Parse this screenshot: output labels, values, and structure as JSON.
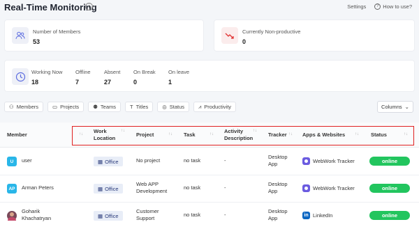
{
  "header": {
    "title": "Real-Time Monitoring",
    "settings": "Settings",
    "how_to_use": "How to use?"
  },
  "cards": {
    "members": {
      "label": "Number of Members",
      "value": "53"
    },
    "non_productive": {
      "label": "Currently Non-productive",
      "value": "0"
    },
    "stats": [
      {
        "label": "Working Now",
        "value": "18"
      },
      {
        "label": "Offline",
        "value": "7"
      },
      {
        "label": "Absent",
        "value": "27"
      },
      {
        "label": "On Break",
        "value": "0"
      },
      {
        "label": "On leave",
        "value": "1"
      }
    ]
  },
  "tabs": [
    "Members",
    "Projects",
    "Teams",
    "Titles",
    "Status",
    "Productivity"
  ],
  "columns_button": "Columns",
  "table": {
    "headers": {
      "member": "Member",
      "work_location_1": "Work",
      "work_location_2": "Location",
      "project": "Project",
      "task": "Task",
      "activity_1": "Activity",
      "activity_2": "Description",
      "tracker": "Tracker",
      "apps": "Apps & Websites",
      "status": "Status"
    },
    "rows": [
      {
        "initials": "U",
        "avatar_color": "#29b6e8",
        "name_1": "user",
        "name_2": "",
        "location": "Office",
        "project_1": "No project",
        "project_2": "",
        "task": "no task",
        "activity": "-",
        "tracker_1": "Desktop",
        "tracker_2": "App",
        "app": "WebWork Tracker",
        "status": "online"
      },
      {
        "initials": "AP",
        "avatar_color": "#29b6e8",
        "name_1": "Arman Peters",
        "name_2": "",
        "location": "Office",
        "project_1": "Web APP",
        "project_2": "Development",
        "task": "no task",
        "activity": "-",
        "tracker_1": "Desktop",
        "tracker_2": "App",
        "app": "WebWork Tracker",
        "status": "online"
      },
      {
        "initials": "",
        "avatar_color": "#7a4a5a",
        "name_1": "Goharik",
        "name_2": "Khachatryan",
        "location": "Office",
        "project_1": "Customer",
        "project_2": "Support",
        "task": "no task",
        "activity": "-",
        "tracker_1": "Desktop",
        "tracker_2": "App",
        "app": "LinkedIn",
        "status": "online"
      }
    ]
  },
  "colors": {
    "online": "#22c55e",
    "highlight_border": "#e02020",
    "accent": "#5b6be0"
  }
}
